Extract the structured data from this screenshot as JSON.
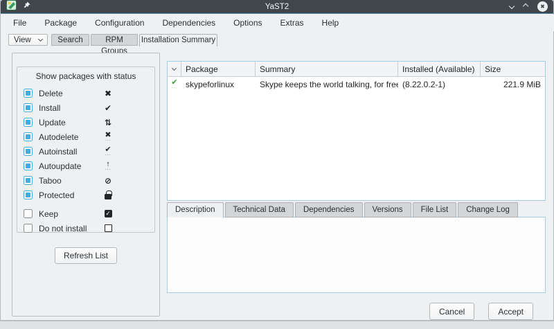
{
  "window": {
    "title": "YaST2",
    "close_glyph": "✖"
  },
  "menubar": {
    "items": [
      "File",
      "Package",
      "Configuration",
      "Dependencies",
      "Options",
      "Extras",
      "Help"
    ]
  },
  "tabbar": {
    "view_button": "View",
    "tabs": [
      "Search",
      "RPM Groups",
      "Installation Summary"
    ],
    "active_tab": "Installation Summary"
  },
  "filter_panel": {
    "title": "Show packages with status",
    "items": [
      {
        "label": "Delete",
        "checked": true,
        "icon": "delete-status-icon",
        "glyph": "✖"
      },
      {
        "label": "Install",
        "checked": true,
        "icon": "install-status-icon",
        "glyph": "✔"
      },
      {
        "label": "Update",
        "checked": true,
        "icon": "update-status-icon",
        "glyph": "⇅"
      },
      {
        "label": "Autodelete",
        "checked": true,
        "icon": "autodelete-status-icon",
        "glyph": "✖",
        "dots": "∙∙∙"
      },
      {
        "label": "Autoinstall",
        "checked": true,
        "icon": "autoinstall-status-icon",
        "glyph": "✔",
        "dots": "∙∙∙"
      },
      {
        "label": "Autoupdate",
        "checked": true,
        "icon": "autoupdate-status-icon",
        "glyph": "↑",
        "dots": "∙∙∙"
      },
      {
        "label": "Taboo",
        "checked": true,
        "icon": "taboo-status-icon",
        "glyph": "⊘"
      },
      {
        "label": "Protected",
        "checked": true,
        "icon": "protected-lock-icon"
      },
      {
        "label": "Keep",
        "checked": false,
        "icon": "keep-status-icon",
        "glyph": "✓"
      },
      {
        "label": "Do not install",
        "checked": false,
        "icon": "do-not-install-status-icon"
      }
    ],
    "refresh_button": "Refresh List"
  },
  "package_table": {
    "columns": [
      "Package",
      "Summary",
      "Installed (Available)",
      "Size"
    ],
    "rows": [
      {
        "status_icon": "autoinstall-status-icon",
        "status_glyph": "✔",
        "status_dots": "∙∙∙",
        "package": "skypeforlinux",
        "summary": "Skype keeps the world talking, for free.",
        "installed_available": "(8.22.0.2-1)",
        "size": "221.9 MiB"
      }
    ]
  },
  "detail_tabs": {
    "tabs": [
      "Description",
      "Technical Data",
      "Dependencies",
      "Versions",
      "File List",
      "Change Log"
    ],
    "active": "Description",
    "content": ""
  },
  "footer": {
    "cancel": "Cancel",
    "accept": "Accept"
  },
  "colors": {
    "accent": "#3daee9",
    "titlebar": "#3f464c",
    "titlebar_underline": "#4d7fa3",
    "window_bg": "#eff0f1",
    "focus_border": "#9fd0ea",
    "checkbox_checked": "#3daee9",
    "row_status_green": "#3a9e3a"
  }
}
